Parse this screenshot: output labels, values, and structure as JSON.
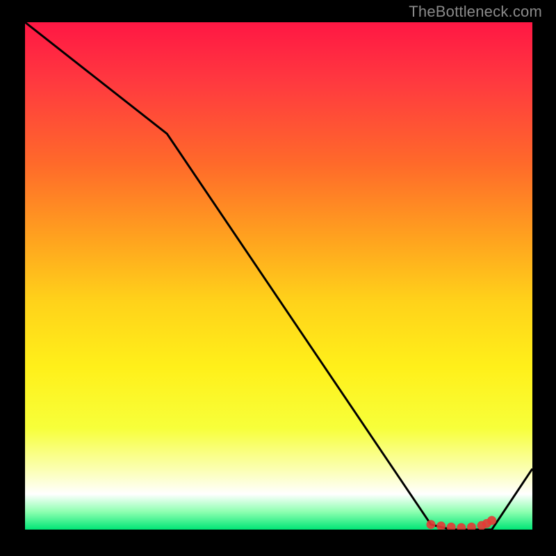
{
  "attribution": "TheBottleneck.com",
  "chart_data": {
    "type": "line",
    "title": "",
    "xlabel": "",
    "ylabel": "",
    "xlim": [
      0,
      100
    ],
    "ylim": [
      0,
      100
    ],
    "series": [
      {
        "name": "curve",
        "x": [
          0,
          28,
          80,
          84,
          92,
          100
        ],
        "y": [
          100,
          78,
          1,
          0,
          0,
          12
        ]
      }
    ],
    "markers": {
      "name": "highlight-band",
      "x": [
        80,
        82,
        84,
        86,
        88,
        90,
        91,
        92
      ],
      "y": [
        1,
        0.7,
        0.5,
        0.4,
        0.5,
        0.8,
        1.2,
        1.8
      ]
    },
    "gradient_stops": [
      {
        "offset": 0.0,
        "color": "#ff1744"
      },
      {
        "offset": 0.12,
        "color": "#ff3a3f"
      },
      {
        "offset": 0.28,
        "color": "#ff6a2a"
      },
      {
        "offset": 0.42,
        "color": "#ffa01f"
      },
      {
        "offset": 0.55,
        "color": "#ffd21a"
      },
      {
        "offset": 0.68,
        "color": "#fff01a"
      },
      {
        "offset": 0.8,
        "color": "#f7ff3a"
      },
      {
        "offset": 0.88,
        "color": "#fbffb0"
      },
      {
        "offset": 0.93,
        "color": "#ffffff"
      },
      {
        "offset": 0.965,
        "color": "#8dffb0"
      },
      {
        "offset": 1.0,
        "color": "#00e676"
      }
    ]
  }
}
